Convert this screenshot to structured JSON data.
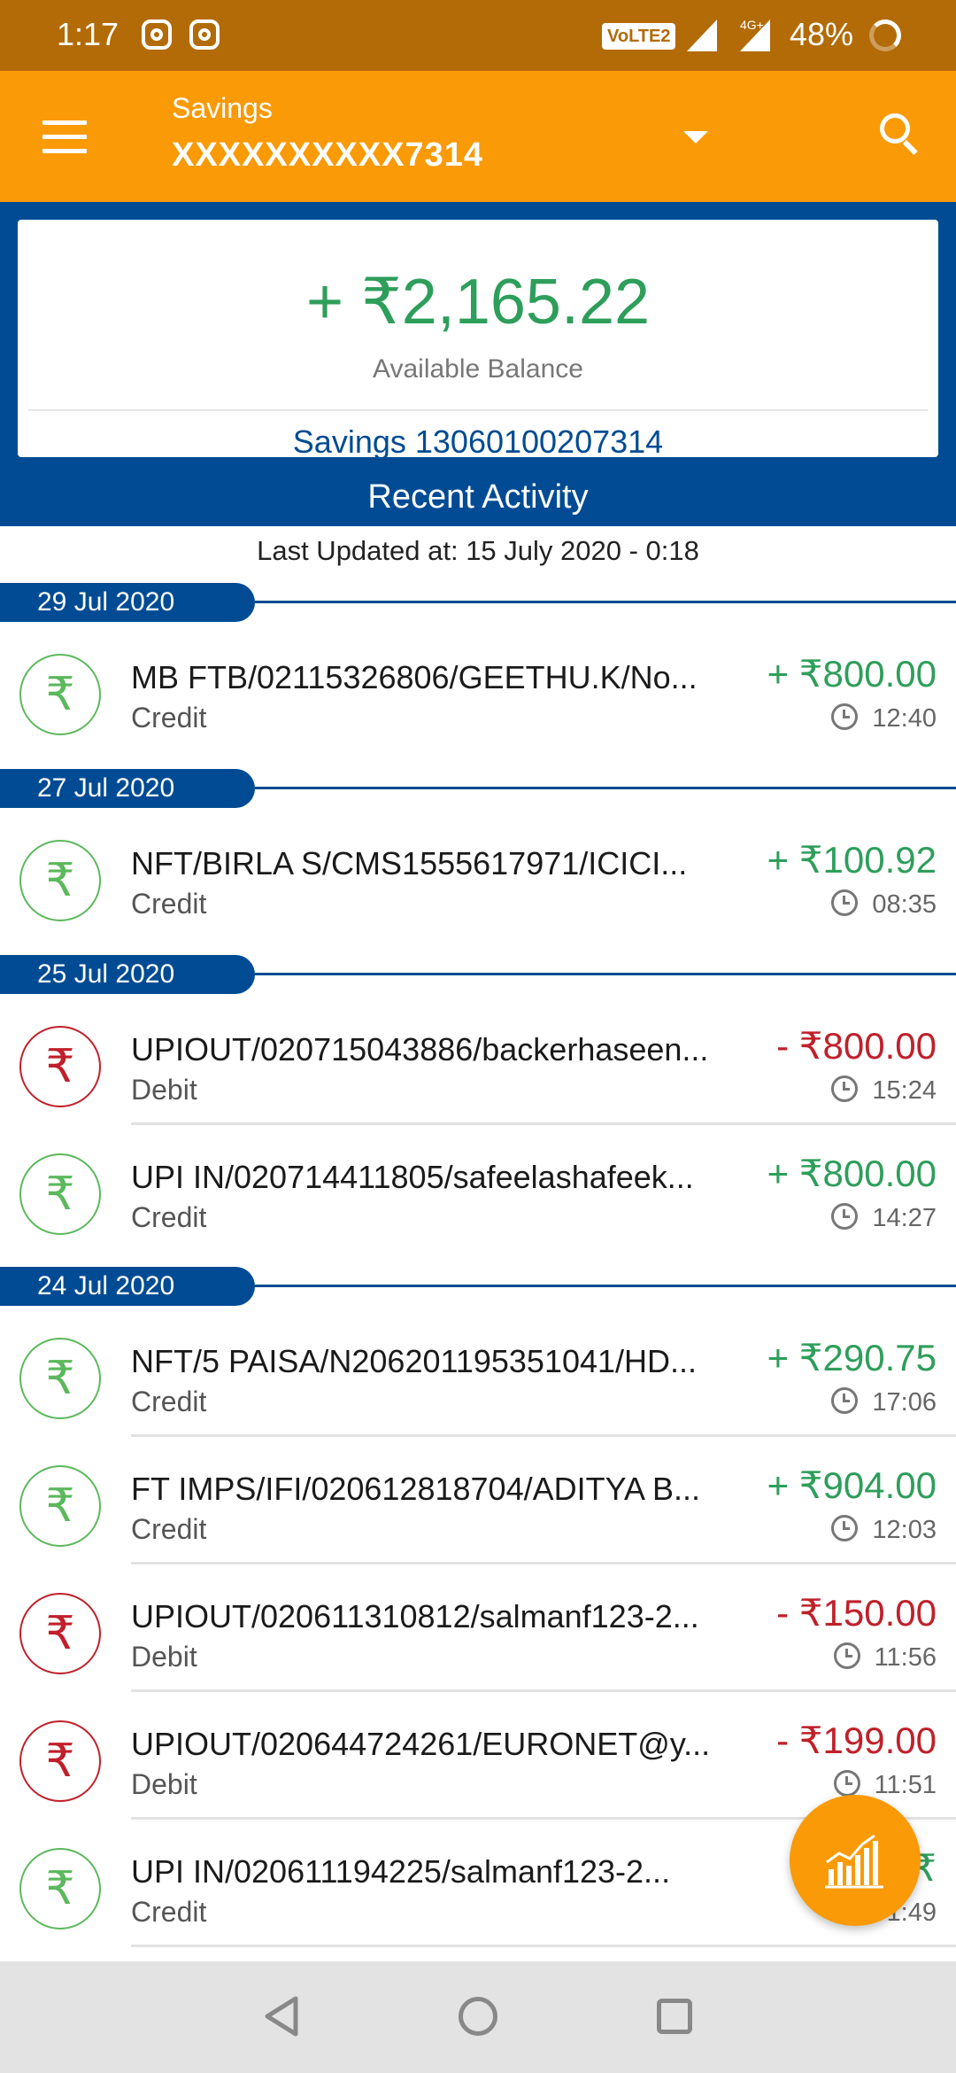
{
  "status_bar": {
    "time": "1:17",
    "volte": "VoLTE2",
    "network": "4G+",
    "battery": "48%"
  },
  "app_bar": {
    "account_type": "Savings",
    "account_number_masked": "XXXXXXXXXX7314"
  },
  "balance": {
    "amount": "+ ₹2,165.22",
    "label": "Available Balance",
    "account": "Savings 13060100207314"
  },
  "recent_activity_title": "Recent Activity",
  "last_updated": "Last Updated at: 15 July 2020 - 0:18",
  "dates": [
    "29 Jul 2020",
    "27 Jul 2020",
    "25 Jul 2020",
    "24 Jul 2020"
  ],
  "transactions": [
    {
      "desc": "MB FTB/02115326806/GEETHU.K/No...",
      "type": "Credit",
      "amount": "+ ₹800.00",
      "time": "12:40",
      "rupee": "₹"
    },
    {
      "desc": "NFT/BIRLA S/CMS1555617971/ICICI...",
      "type": "Credit",
      "amount": "+ ₹100.92",
      "time": "08:35",
      "rupee": "₹"
    },
    {
      "desc": "UPIOUT/020715043886/backerhaseen...",
      "type": "Debit",
      "amount": "- ₹800.00",
      "time": "15:24",
      "rupee": "₹"
    },
    {
      "desc": "UPI IN/020714411805/safeelashafeek...",
      "type": "Credit",
      "amount": "+ ₹800.00",
      "time": "14:27",
      "rupee": "₹"
    },
    {
      "desc": "NFT/5 PAISA/N206201195351041/HD...",
      "type": "Credit",
      "amount": "+ ₹290.75",
      "time": "17:06",
      "rupee": "₹"
    },
    {
      "desc": "FT IMPS/IFI/020612818704/ADITYA B...",
      "type": "Credit",
      "amount": "+ ₹904.00",
      "time": "12:03",
      "rupee": "₹"
    },
    {
      "desc": "UPIOUT/020611310812/salmanf123-2...",
      "type": "Debit",
      "amount": "- ₹150.00",
      "time": "11:56",
      "rupee": "₹"
    },
    {
      "desc": "UPIOUT/020644724261/EURONET@y...",
      "type": "Debit",
      "amount": "- ₹199.00",
      "time": "11:51",
      "rupee": "₹"
    },
    {
      "desc": "UPI IN/020611194225/salmanf123-2...",
      "type": "Credit",
      "amount": "+ ₹",
      "time": "1:49",
      "rupee": "₹"
    }
  ],
  "colors": {
    "status_bar": "#b36b07",
    "app_bar": "#f99a06",
    "primary_blue": "#004b93",
    "credit_green": "#2e9e5b",
    "debit_red": "#c0202a"
  },
  "icons": [
    "instagram-icon",
    "signal-icon",
    "battery-icon",
    "menu-icon",
    "chevron-down-icon",
    "search-icon",
    "rupee-icon",
    "clock-icon",
    "analytics-chart-icon",
    "back-icon",
    "home-icon",
    "recents-icon"
  ]
}
